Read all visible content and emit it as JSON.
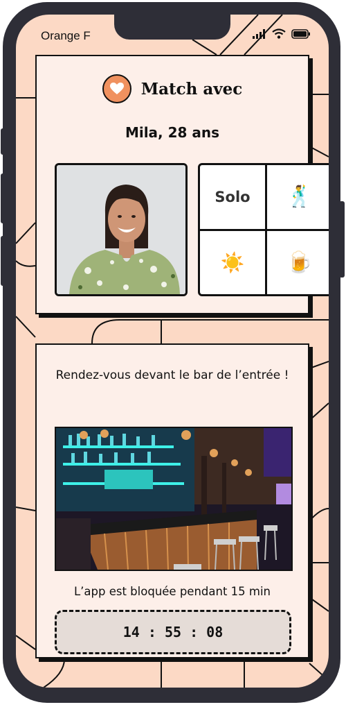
{
  "status_bar": {
    "carrier": "Orange F",
    "icons": [
      "signal-icon",
      "wifi-icon",
      "battery-icon"
    ]
  },
  "match_card": {
    "title": "Match avec",
    "name": "Mila, 28 ans",
    "heart_icon": "heart-icon",
    "accent_color": "#f0915f",
    "tiles": [
      {
        "type": "text",
        "label": "Solo"
      },
      {
        "type": "emoji",
        "label": "🕺"
      },
      {
        "type": "emoji",
        "label": "☀️"
      },
      {
        "type": "emoji",
        "label": "🍺"
      }
    ]
  },
  "meet_card": {
    "message": "Rendez-vous devant le bar de l’entrée !",
    "blocked_text": "L’app est bloquée pendant 15 min",
    "timer": "14 : 55 : 08"
  },
  "colors": {
    "background": "#fcd9c5",
    "card": "#fdefe9",
    "frame": "#2e2e37",
    "timer_bg": "#e5dcd7"
  }
}
